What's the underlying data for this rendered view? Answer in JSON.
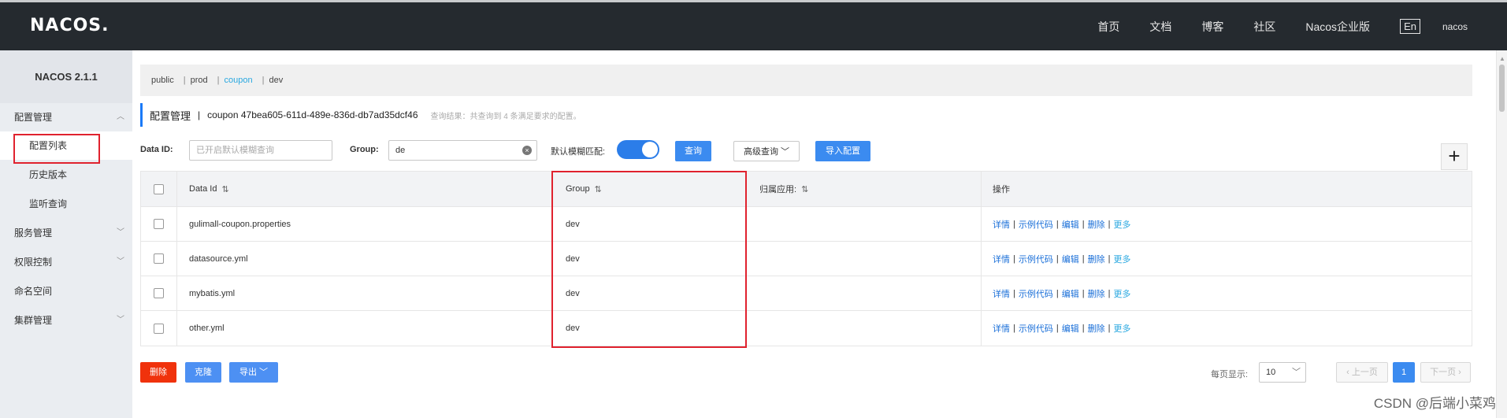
{
  "topbar": {
    "logo": "NACOS.",
    "nav": [
      "首页",
      "文档",
      "博客",
      "社区",
      "Nacos企业版"
    ],
    "lang": "En",
    "user": "nacos"
  },
  "sidebar": {
    "title": "NACOS 2.1.1",
    "items": [
      {
        "label": "配置管理",
        "type": "parent",
        "chevron": "up"
      },
      {
        "label": "配置列表",
        "type": "child",
        "active": true
      },
      {
        "label": "历史版本",
        "type": "child"
      },
      {
        "label": "监听查询",
        "type": "child"
      },
      {
        "label": "服务管理",
        "type": "parent",
        "chevron": "down"
      },
      {
        "label": "权限控制",
        "type": "parent",
        "chevron": "down"
      },
      {
        "label": "命名空间",
        "type": "parent"
      },
      {
        "label": "集群管理",
        "type": "parent",
        "chevron": "down"
      }
    ]
  },
  "namespaces": {
    "items": [
      "public",
      "prod",
      "coupon",
      "dev"
    ],
    "active": "coupon"
  },
  "header": {
    "title": "配置管理",
    "separator": "|",
    "namespace": "coupon  47bea605-611d-489e-836d-db7ad35dcf46",
    "result_note": "查询结果：共查询到 4 条满足要求的配置。"
  },
  "filters": {
    "dataid_label": "Data ID:",
    "dataid_placeholder": "已开启默认模糊查询",
    "group_label": "Group:",
    "group_value": "de",
    "fuzzy_label": "默认模糊匹配:",
    "fuzzy_on": true,
    "search_button": "查询",
    "advanced_button": "高级查询",
    "import_button": "导入配置",
    "add_icon": "plus-icon"
  },
  "table": {
    "headers": [
      "Data Id",
      "Group",
      "归属应用:",
      "操作"
    ],
    "rows": [
      {
        "data_id": "gulimall-coupon.properties",
        "group": "dev",
        "app": ""
      },
      {
        "data_id": "datasource.yml",
        "group": "dev",
        "app": ""
      },
      {
        "data_id": "mybatis.yml",
        "group": "dev",
        "app": ""
      },
      {
        "data_id": "other.yml",
        "group": "dev",
        "app": ""
      }
    ],
    "ops": [
      "详情",
      "示例代码",
      "编辑",
      "删除",
      "更多"
    ]
  },
  "bottom": {
    "delete_button": "删除",
    "clone_button": "克隆",
    "export_button": "导出",
    "page_size_label": "每页显示:",
    "page_size": "10",
    "prev": "上一页",
    "current_page": "1",
    "next": "下一页"
  },
  "watermark": "CSDN @后端小菜鸡",
  "colors": {
    "topbar": "#252a2f",
    "primary": "#3b8bf0",
    "highlight_box": "#e0222e",
    "active_ns": "#2aa8e0"
  }
}
